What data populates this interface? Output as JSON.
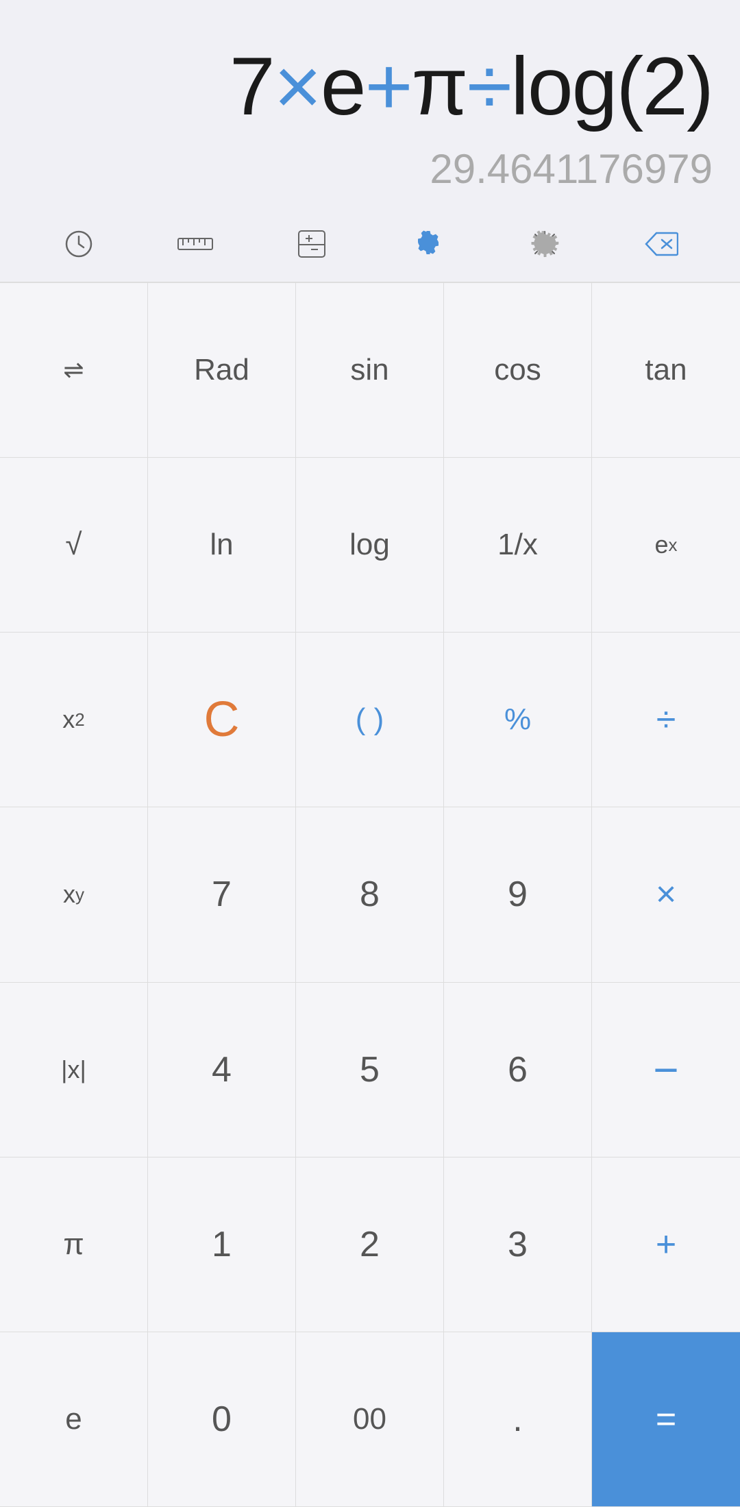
{
  "display": {
    "expression_parts": [
      {
        "text": "7",
        "type": "normal"
      },
      {
        "text": "×",
        "type": "blue"
      },
      {
        "text": "e",
        "type": "normal"
      },
      {
        "text": "+",
        "type": "blue"
      },
      {
        "text": "π",
        "type": "normal"
      },
      {
        "text": "÷",
        "type": "blue"
      },
      {
        "text": "log(2)",
        "type": "normal"
      }
    ],
    "expression_full": "7×e+π÷log(2)",
    "result": "29.4641176979"
  },
  "toolbar": {
    "history_label": "history",
    "ruler_label": "ruler",
    "plusminus_label": "plus-minus",
    "theme_label": "theme",
    "settings_label": "settings",
    "backspace_label": "backspace"
  },
  "keys": {
    "row1": [
      "⇌",
      "Rad",
      "sin",
      "cos",
      "tan"
    ],
    "row2": [
      "√",
      "ln",
      "log",
      "1/x",
      "eˣ"
    ],
    "row3": [
      "x²",
      "C",
      "( )",
      "%",
      "÷"
    ],
    "row4": [
      "xʸ",
      "7",
      "8",
      "9",
      "×"
    ],
    "row5": [
      "|x|",
      "4",
      "5",
      "6",
      "−"
    ],
    "row6": [
      "π",
      "1",
      "2",
      "3",
      "+"
    ],
    "row7": [
      "e",
      "0",
      "00",
      ".",
      "="
    ]
  },
  "colors": {
    "blue": "#4a90d9",
    "orange": "#e07a3a",
    "background": "#f0f0f5",
    "key_bg": "#f5f5f8",
    "border": "#ddd",
    "text_normal": "#555",
    "text_dim": "#aaa"
  }
}
